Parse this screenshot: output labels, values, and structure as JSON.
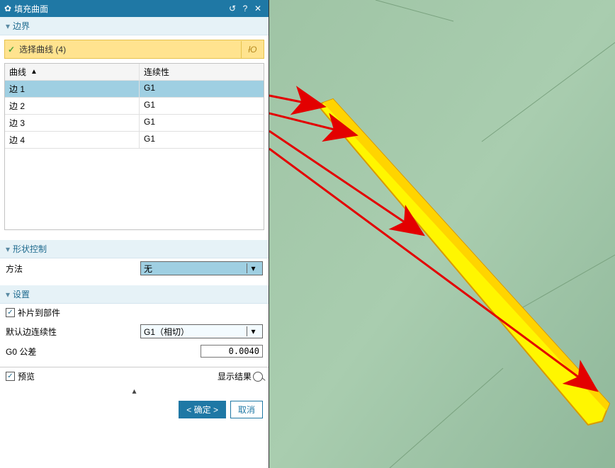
{
  "titlebar": {
    "title": "填充曲面",
    "reset_icon": "↺",
    "help_icon": "?",
    "close_icon": "✕"
  },
  "sections": {
    "boundary": "边界",
    "shape": "形状控制",
    "settings": "设置"
  },
  "curve_select": {
    "label": "选择曲线 (4)",
    "icon_label": "łO"
  },
  "table": {
    "col_curve": "曲线",
    "col_cont": "连续性",
    "rows": [
      {
        "curve": "边 1",
        "cont": "G1",
        "selected": true
      },
      {
        "curve": "边 2",
        "cont": "G1",
        "selected": false
      },
      {
        "curve": "边 3",
        "cont": "G1",
        "selected": false
      },
      {
        "curve": "边 4",
        "cont": "G1",
        "selected": false
      }
    ]
  },
  "shape": {
    "method_label": "方法",
    "method_value": "无"
  },
  "settings": {
    "patch_to_part": "补片到部件",
    "default_cont_label": "默认边连续性",
    "default_cont_value": "G1（相切）",
    "g0_label": "G0 公差",
    "g0_value": "0.0040"
  },
  "preview": {
    "label": "预览",
    "show_result": "显示结果"
  },
  "buttons": {
    "ok": "< 确定 >",
    "cancel": "取消"
  }
}
